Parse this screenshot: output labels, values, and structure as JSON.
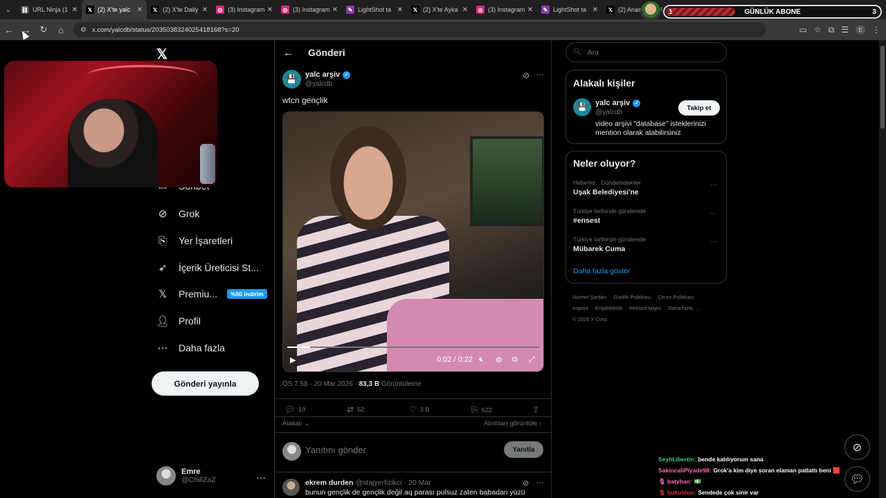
{
  "browser": {
    "tabs": [
      {
        "label": "URL Ninja (1",
        "fav": "#4a4a4a",
        "glyph": "⛓"
      },
      {
        "label": "(2) X'te yalc",
        "fav": "#000",
        "glyph": "𝕏"
      },
      {
        "label": "(2) X'te Daily",
        "fav": "#000",
        "glyph": "𝕏"
      },
      {
        "label": "(3) Instagram",
        "fav": "#d6297a",
        "glyph": "◎"
      },
      {
        "label": "(3) Instagram",
        "fav": "#d6297a",
        "glyph": "◎"
      },
      {
        "label": "LightShot ta",
        "fav": "#8a3aa8",
        "glyph": "✎"
      },
      {
        "label": "(2) X'te Ayka",
        "fav": "#000",
        "glyph": "𝕏"
      },
      {
        "label": "(3) Instagram",
        "fav": "#d6297a",
        "glyph": "◎"
      },
      {
        "label": "LightShot ta",
        "fav": "#8a3aa8",
        "glyph": "✎"
      },
      {
        "label": "(2) Anasayfa",
        "fav": "#000",
        "glyph": "𝕏"
      }
    ],
    "url": "x.com/yalcdb/status/2035038324025418168?s=20",
    "profile_initial": "E"
  },
  "overlay": {
    "abone_left": "1",
    "abone_label": "GÜNLÜK ABONE",
    "abone_right": "3"
  },
  "nav": {
    "items": [
      {
        "label": "Sohbet",
        "icon": "chat-icon"
      },
      {
        "label": "Grok",
        "icon": "grok-icon"
      },
      {
        "label": "Yer İşaretleri",
        "icon": "bookmark-icon"
      },
      {
        "label": "İçerik Üreticisi St...",
        "icon": "rocket-icon"
      },
      {
        "label": "Premiu...",
        "icon": "x-premium-icon",
        "badge": "%50 indirim"
      },
      {
        "label": "Profil",
        "icon": "profile-icon"
      },
      {
        "label": "Daha fazla",
        "icon": "more-circle-icon"
      }
    ],
    "post_button": "Gönderi yayınla",
    "me": {
      "name": "Emre",
      "handle": "@ChillZaZ"
    }
  },
  "post": {
    "header_title": "Gönderi",
    "author_name": "yalc arşiv",
    "author_handle": "@yalcdb",
    "text": "wtcn gençlik",
    "video_time": "0:02 / 0:22",
    "video_progress": 0.09,
    "meta_time": "ÖS 7:58 · 20 Mar 2026 · ",
    "views_count": "83,3 B",
    "views_label": "Görüntüleme",
    "actions": {
      "replies": "19",
      "reposts": "62",
      "likes": "3 B",
      "bookmarks": "622"
    },
    "relevant": "Alakalı",
    "quotes": "Alıntıları görüntüle",
    "reply_placeholder": "Yanıtını gönder",
    "reply_button": "Yanıtla"
  },
  "comment": {
    "name": "ekrem durden",
    "handle": "@stajyerfizikci",
    "date": "· 20 Mar",
    "text": "bunun gençlik de gençlik değil aq parası pulsuz zaten babadan yüzü"
  },
  "sidebar": {
    "search_placeholder": "Ara",
    "relevant_title": "Alakalı kişiler",
    "person_name": "yalc arşiv",
    "person_handle": "@yalcdb",
    "follow_label": "Takip et",
    "person_bio": "video arşivi “database” isteklerinizi mention olarak atabilirsiniz",
    "trends_title": "Neler oluyor?",
    "trends": [
      {
        "meta": "Haberler · Gündemdekiler",
        "name": "Uşak Belediyesi'ne"
      },
      {
        "meta": "Türkiye tarihinde gündemde",
        "name": "#ensest"
      },
      {
        "meta": "Türkiye tarihinde gündemde",
        "name": "Mübarek Cuma"
      }
    ],
    "show_more": "Daha fazla göster",
    "footer": [
      "Hizmet Şartları",
      "Gizlilik Politikası",
      "Çerez Politikası",
      "Imprint",
      "Erişilebilirlik",
      "Reklam bilgisi",
      "Daha fazla ...",
      "© 2026 X Corp."
    ]
  },
  "chat": [
    {
      "user": "SeyhLibertin:",
      "color": "#3ecf6a",
      "msg": "bende katılıyorum sana"
    },
    {
      "user": "SakincaliPiyade98:",
      "color": "#ff6bb0",
      "msg": "Grok'a kim diye soran elaman patlattı beni 🟥"
    },
    {
      "user": "🎙 batyhan:",
      "color": "#ff6bb0",
      "msg": "💵"
    },
    {
      "user": "🎙 bukuldun:",
      "color": "#e03030",
      "msg": "Sendede çok sinir var"
    }
  ]
}
